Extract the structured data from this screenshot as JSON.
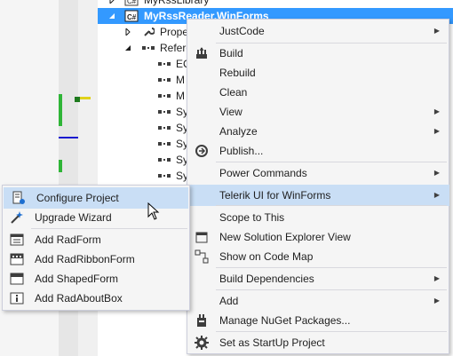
{
  "colors": {
    "selection": "#3399ff",
    "menu_hover": "#c9def5",
    "menu_bg": "#f5f5f5",
    "menu_border": "#cccedb"
  },
  "tree": {
    "library_label": "MyRssLibrary",
    "project_label": "MyRssReader.WinForms",
    "properties_label": "Prope",
    "references_label": "Refere",
    "reference_items": [
      "EC",
      "M",
      "M",
      "Sy",
      "Sy",
      "Sy",
      "Sy",
      "Sy"
    ]
  },
  "context_menu": {
    "items": [
      {
        "label": "JustCode",
        "submenu": true
      },
      {
        "label": "Build"
      },
      {
        "label": "Rebuild"
      },
      {
        "label": "Clean"
      },
      {
        "label": "View",
        "submenu": true
      },
      {
        "label": "Analyze",
        "submenu": true
      },
      {
        "label": "Publish..."
      },
      {
        "label": "Power Commands",
        "submenu": true
      },
      {
        "label": "Telerik UI for WinForms",
        "submenu": true
      },
      {
        "label": "Scope to This"
      },
      {
        "label": "New Solution Explorer View"
      },
      {
        "label": "Show on Code Map"
      },
      {
        "label": "Build Dependencies",
        "submenu": true
      },
      {
        "label": "Add",
        "submenu": true
      },
      {
        "label": "Manage NuGet Packages..."
      },
      {
        "label": "Set as StartUp Project"
      }
    ]
  },
  "telerik_submenu": {
    "items": [
      {
        "label": "Configure Project",
        "icon": "configure-project-icon"
      },
      {
        "label": "Upgrade Wizard",
        "icon": "wand-icon"
      },
      {
        "label": "Add RadForm",
        "icon": "form-icon"
      },
      {
        "label": "Add RadRibbonForm",
        "icon": "ribbon-form-icon"
      },
      {
        "label": "Add ShapedForm",
        "icon": "shaped-form-icon"
      },
      {
        "label": "Add RadAboutBox",
        "icon": "about-box-icon"
      }
    ]
  }
}
